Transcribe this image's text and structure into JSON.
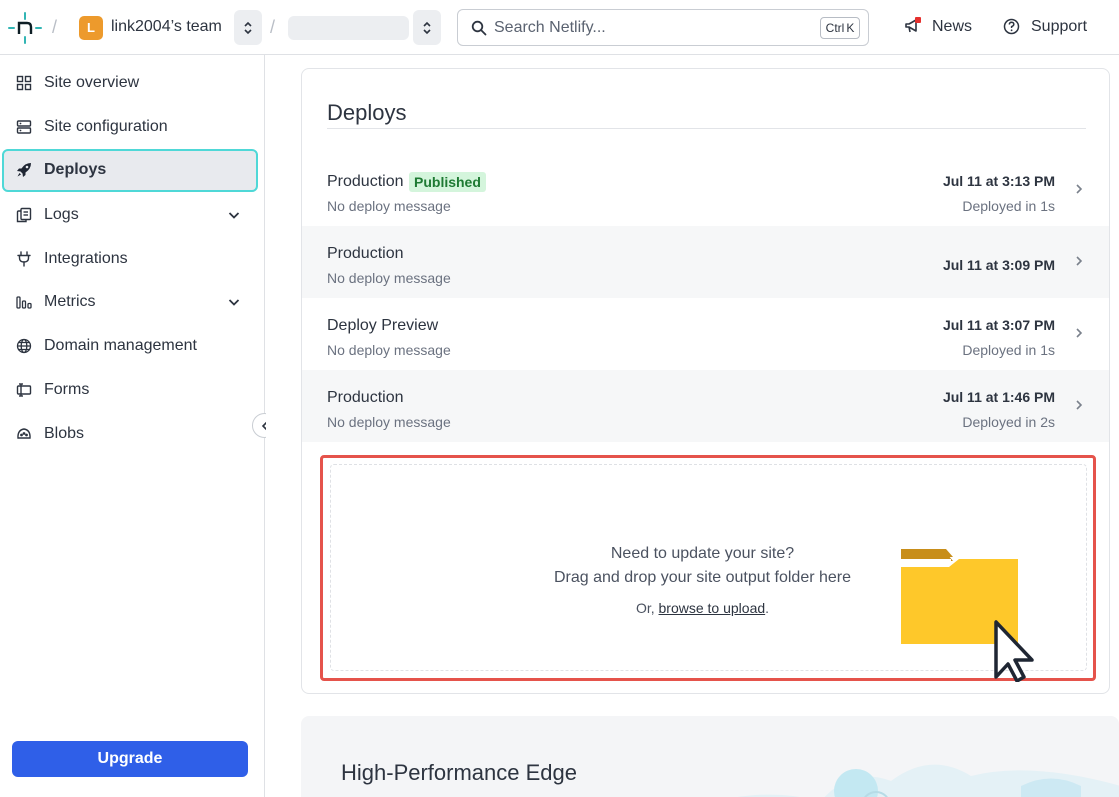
{
  "topbar": {
    "team_initial": "L",
    "team_name": "link2004’s team",
    "search_placeholder": "Search Netlify...",
    "search_shortcut": "Ctrl K",
    "news_label": "News",
    "support_label": "Support"
  },
  "sidebar": {
    "items": [
      {
        "label": "Site overview",
        "icon": "grid-icon"
      },
      {
        "label": "Site configuration",
        "icon": "server-icon"
      },
      {
        "label": "Deploys",
        "icon": "rocket-icon",
        "active": true
      },
      {
        "label": "Logs",
        "icon": "logs-icon",
        "expandable": true
      },
      {
        "label": "Integrations",
        "icon": "plug-icon"
      },
      {
        "label": "Metrics",
        "icon": "bar-chart-icon",
        "expandable": true
      },
      {
        "label": "Domain management",
        "icon": "globe-icon"
      },
      {
        "label": "Forms",
        "icon": "form-icon"
      },
      {
        "label": "Blobs",
        "icon": "blob-icon"
      }
    ],
    "upgrade_label": "Upgrade"
  },
  "deploys": {
    "title": "Deploys",
    "rows": [
      {
        "title": "Production",
        "badge": "Published",
        "message": "No deploy message",
        "time": "Jul 11 at 3:13 PM",
        "duration": "Deployed in 1s"
      },
      {
        "title": "Production",
        "message": "No deploy message",
        "time": "Jul 11 at 3:09 PM"
      },
      {
        "title": "Deploy Preview",
        "message": "No deploy message",
        "time": "Jul 11 at 3:07 PM",
        "duration": "Deployed in 1s"
      },
      {
        "title": "Production",
        "message": "No deploy message",
        "time": "Jul 11 at 1:46 PM",
        "duration": "Deployed in 2s"
      }
    ],
    "dropzone": {
      "line1": "Need to update your site?",
      "line2": "Drag and drop your site output folder here",
      "line3_prefix": "Or, ",
      "link": "browse to upload",
      "line3_suffix": "."
    }
  },
  "edge": {
    "title": "High-Performance Edge"
  },
  "colors": {
    "accent": "#2f5fe8",
    "active_border": "#4fd8d7",
    "badge_bg": "#d4f5dc",
    "badge_text": "#1e7a33",
    "highlight": "#e5534b",
    "folder": "#fec82a"
  }
}
